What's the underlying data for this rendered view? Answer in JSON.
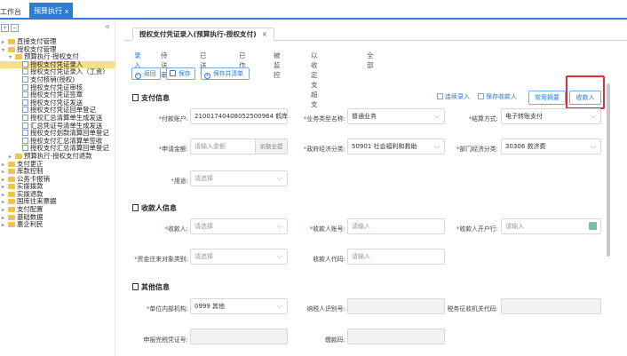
{
  "topbar": {
    "workbench": "工作台",
    "active_tab": "预算执行",
    "close": "x"
  },
  "sidebar": {
    "collapse": "«",
    "items": [
      {
        "label": "直接支付管理",
        "type": "folder",
        "level": 0,
        "arrow": "▸"
      },
      {
        "label": "授权支付管理",
        "type": "folder",
        "level": 0,
        "arrow": "▾"
      },
      {
        "label": "预算执行-授权支付",
        "type": "folder",
        "level": 1,
        "arrow": "▾"
      },
      {
        "label": "授权支付凭证录入",
        "type": "file",
        "level": 2,
        "selected": true
      },
      {
        "label": "授权支付凭证录入（工资）",
        "type": "file",
        "level": 2
      },
      {
        "label": "支付核销(授权)",
        "type": "file",
        "level": 2
      },
      {
        "label": "授权支付凭证审核",
        "type": "file",
        "level": 2
      },
      {
        "label": "授权支付凭证签章",
        "type": "file",
        "level": 2
      },
      {
        "label": "授权支付凭证发送",
        "type": "file",
        "level": 2
      },
      {
        "label": "授权支付凭证回单登记",
        "type": "file",
        "level": 2
      },
      {
        "label": "授权汇总清算单生成发送",
        "type": "file",
        "level": 2
      },
      {
        "label": "汇总凭证号清单生成发送",
        "type": "file",
        "level": 2
      },
      {
        "label": "授权支付划款清算回单登记",
        "type": "file",
        "level": 2
      },
      {
        "label": "授权支付汇总清算单签收",
        "type": "file",
        "level": 2
      },
      {
        "label": "授权支付汇总清算回单登记",
        "type": "file",
        "level": 2
      },
      {
        "label": "预算执行-授权支付退款",
        "type": "folder",
        "level": 1,
        "arrow": "▸"
      },
      {
        "label": "支付更正",
        "type": "folder",
        "level": 0,
        "arrow": "▸"
      },
      {
        "label": "库款控制",
        "type": "folder",
        "level": 0,
        "arrow": "▸"
      },
      {
        "label": "公务卡报销",
        "type": "folder",
        "level": 0,
        "arrow": "▸"
      },
      {
        "label": "实拨拨款",
        "type": "folder",
        "level": 0,
        "arrow": "▸"
      },
      {
        "label": "实拨退款",
        "type": "folder",
        "level": 0,
        "arrow": "▸"
      },
      {
        "label": "国库往来票据",
        "type": "folder",
        "level": 0,
        "arrow": "▸"
      },
      {
        "label": "支付配置",
        "type": "folder",
        "level": 0,
        "arrow": "▸"
      },
      {
        "label": "基础数据",
        "type": "folder",
        "level": 0,
        "arrow": "▸"
      },
      {
        "label": "惠企利民",
        "type": "folder",
        "level": 0,
        "arrow": "▸"
      }
    ]
  },
  "main": {
    "subtab": {
      "label": "授权支付凭证录入(预算执行-授权支付)",
      "close": "×"
    },
    "status_tabs": [
      "录入",
      "待送审",
      "已送审",
      "已作废",
      "被监控",
      "以收定支超支",
      "全部"
    ],
    "buttons": {
      "back": "返回",
      "save": "保存",
      "save_new": "保存并清单"
    },
    "payment_section": {
      "title": "支付信息",
      "continuous_entry": "连续录入",
      "save_payee": "保存收款人",
      "common_summary": "常用摘要",
      "payee_button": "收款人",
      "payer_account_label": "付款账户:",
      "payer_account_value": "210017404080525009​64 鹤岸乡",
      "business_type_label": "业务类型名称:",
      "business_type_value": "普通业务",
      "settlement_label": "结算方式:",
      "settlement_value": "电子转账支付",
      "amount_label": "申请金额:",
      "amount_placeholder": "请输入金额",
      "amount_btn": "余额全提",
      "gov_econ_label": "政府经济分类:",
      "gov_econ_value": "50901 社会福利和救助",
      "dept_econ_label": "部门经济分类:",
      "dept_econ_value": "30306 救济费",
      "purpose_label": "用途:",
      "purpose_placeholder": "请选择"
    },
    "payee_section": {
      "title": "收款人信息",
      "payee_label": "收款人:",
      "payee_placeholder": "请选择",
      "account_label": "收款人账号:",
      "account_placeholder": "请输入",
      "bank_label": "收款人开户行:",
      "bank_placeholder": "请输入",
      "fund_type_label": "资金往来对象类别:",
      "fund_type_placeholder": "请选择",
      "payee_code_label": "收款人代码:",
      "payee_code_placeholder": "请输入"
    },
    "other_section": {
      "title": "其他信息",
      "internal_org_label": "单位内部机构:",
      "internal_org_value": "0999 其他",
      "taxpayer_id_label": "纳税人识别号:",
      "tax_authority_label": "税务征收机关代码:",
      "declaration_label": "申报完税凭证号:",
      "tax_code_label": "缴款码:"
    }
  }
}
